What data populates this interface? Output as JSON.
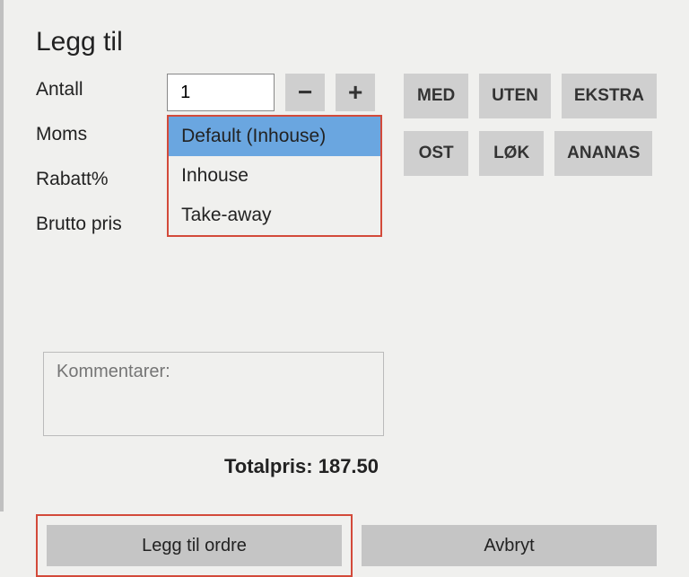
{
  "title": "Legg til",
  "labels": {
    "qty": "Antall",
    "vat": "Moms",
    "discount": "Rabatt%",
    "gross": "Brutto pris"
  },
  "qty_value": "1",
  "minus_glyph": "−",
  "plus_glyph": "+",
  "vat_options": {
    "opt0": "Default (Inhouse)",
    "opt1": "Inhouse",
    "opt2": "Take-away"
  },
  "modifiers": {
    "row1": {
      "a": "MED",
      "b": "UTEN",
      "c": "EKSTRA"
    },
    "row2": {
      "a": "OST",
      "b": "LØK",
      "c": "ANANAS"
    }
  },
  "comments_placeholder": "Kommentarer:",
  "total_label": "Totalpris: ",
  "total_value": "187.50",
  "buttons": {
    "add": "Legg til ordre",
    "cancel": "Avbryt"
  }
}
